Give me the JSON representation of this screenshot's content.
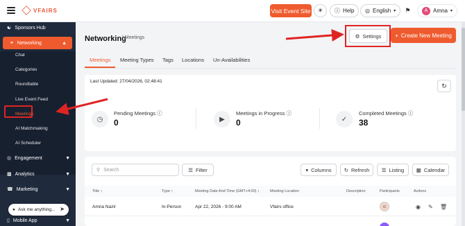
{
  "header": {
    "logo_text": "VFAIRS",
    "visit_label": "Visit Event Site",
    "help_label": "Help",
    "language": "English",
    "user_initial": "A",
    "user_name": "Amna"
  },
  "sidebar": {
    "sponsors": "Sponsors Hub",
    "networking": "Networking",
    "sub_items": [
      "Chat",
      "Categories",
      "Roundtable",
      "Live Event Feed",
      "Meetings",
      "AI Matchmaking",
      "AI Scheduler"
    ],
    "engagement": "Engagement",
    "analytics": "Analytics",
    "marketing": "Marketing",
    "mobile_app": "Mobile App",
    "ask_label": "Ask me anything..."
  },
  "page": {
    "title": "Networking",
    "breadcrumb": "Meetings",
    "settings_label": "Settings",
    "create_label": "Create New Meeting",
    "tabs": [
      "Meetings",
      "Meeting Types",
      "Tags",
      "Locations",
      "Un-Availabilities"
    ]
  },
  "stats": {
    "last_updated": "Last Updated: 27/04/2026, 02:48:41",
    "pending_label": "Pending Meetings",
    "pending_value": "0",
    "progress_label": "Meetings in Progress",
    "progress_value": "0",
    "completed_label": "Completed Meetings",
    "completed_value": "38"
  },
  "table": {
    "search_placeholder": "Search",
    "filter_label": "Filter",
    "columns_label": "Columns",
    "refresh_label": "Refresh",
    "listing_label": "Listing",
    "calendar_label": "Calendar",
    "headers": [
      "Title",
      "Type",
      "Meeting Date And Time (GMT+4:00)",
      "Meeting Location",
      "Description",
      "Participants",
      "Actions"
    ],
    "rows": [
      {
        "title": "Amna Nazir",
        "type": "In-Person",
        "datetime": "Apr 22, 2026 - 9:00 AM",
        "location": "Vfairs office",
        "description": ""
      }
    ]
  },
  "colors": {
    "accent": "#ef5b2e",
    "sidebar_bg": "#1f2a3c",
    "highlight_red": "#e02424"
  }
}
